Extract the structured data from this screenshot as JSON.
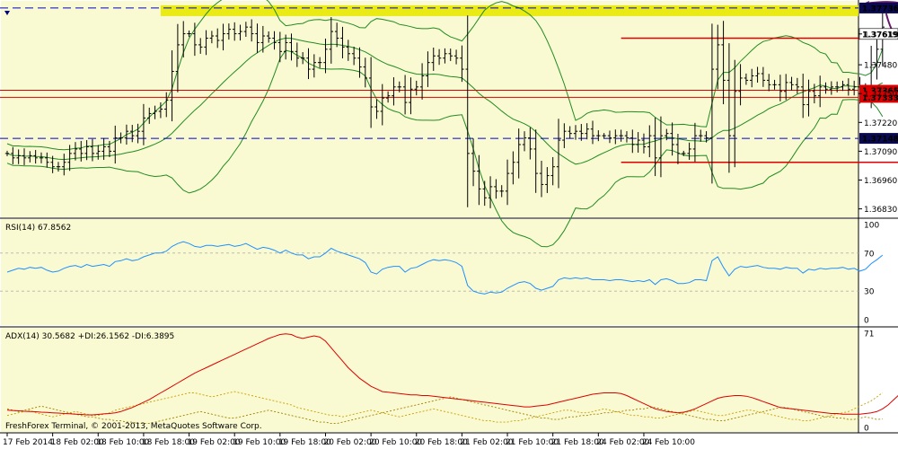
{
  "terminal": {
    "copyright": "FreshForex Terminal, © 2001-2013, MetaQuotes Software Corp."
  },
  "colors": {
    "background": "#fafad2",
    "price_bars": "#000000",
    "bands": "#228b22",
    "horizontal_lines": "#dd0000",
    "dashed_lines": "#0000cc",
    "highlight": "#e8e800",
    "rsi_line": "#1e90ff",
    "adx_line": "#dd0000",
    "di_plus": "#c8a000",
    "di_minus": "#a08000",
    "arrow": "#6a1a6a",
    "label_dark": "#0a0a50",
    "label_red": "#dd0000"
  },
  "chart_data": [
    {
      "type": "line",
      "panel": "price",
      "y_ticks": [
        "1.37619",
        "1.37480",
        "1.37350",
        "1.37220",
        "1.37090",
        "1.36960",
        "1.36830"
      ],
      "ylim": [
        1.368,
        1.3776
      ],
      "levels": [
        {
          "price": 1.37736,
          "label": "1.37736",
          "style": "dashed"
        },
        {
          "price": 1.37619,
          "label": "1.37619",
          "style": "price"
        },
        {
          "price": 1.37365,
          "label": "1.37365",
          "style": "solid"
        },
        {
          "price": 1.37333,
          "label": "1.37333",
          "style": "solid"
        },
        {
          "price": 1.37148,
          "label": "1.37148",
          "style": "dashed"
        }
      ],
      "segments": [
        {
          "price": 1.376,
          "from_index": 108,
          "to_index": 158
        },
        {
          "price": 1.3704,
          "from_index": 108,
          "to_index": 158
        }
      ],
      "x_labels": [
        "17 Feb 2014",
        "18 Feb 02:00",
        "18 Feb 10:00",
        "18 Feb 18:00",
        "19 Feb 02:00",
        "19 Feb 10:00",
        "19 Feb 18:00",
        "20 Feb 02:00",
        "20 Feb 10:00",
        "20 Feb 18:00",
        "21 Feb 02:00",
        "21 Feb 10:00",
        "21 Feb 18:00",
        "24 Feb 02:00",
        "24 Feb 10:00"
      ],
      "closes": [
        1.3708,
        1.3706,
        1.3707,
        1.3706,
        1.3707,
        1.3706,
        1.3706,
        1.3704,
        1.3702,
        1.3702,
        1.3704,
        1.3708,
        1.371,
        1.3708,
        1.3711,
        1.3708,
        1.3709,
        1.3711,
        1.3709,
        1.3715,
        1.3715,
        1.3718,
        1.3716,
        1.3718,
        1.3724,
        1.3726,
        1.3727,
        1.3728,
        1.3732,
        1.3745,
        1.3757,
        1.3762,
        1.3762,
        1.3757,
        1.3756,
        1.376,
        1.3761,
        1.3759,
        1.3762,
        1.3764,
        1.3762,
        1.3763,
        1.3765,
        1.3762,
        1.3758,
        1.3761,
        1.376,
        1.3758,
        1.3754,
        1.3758,
        1.3754,
        1.3751,
        1.3751,
        1.3746,
        1.3749,
        1.3749,
        1.3755,
        1.3763,
        1.376,
        1.3756,
        1.3753,
        1.3751,
        1.3747,
        1.3742,
        1.3729,
        1.3727,
        1.3733,
        1.3734,
        1.3738,
        1.3738,
        1.3731,
        1.3737,
        1.3738,
        1.3743,
        1.3749,
        1.3752,
        1.3751,
        1.3753,
        1.3752,
        1.3751,
        1.3746,
        1.3708,
        1.37,
        1.3692,
        1.3688,
        1.3693,
        1.3691,
        1.3691,
        1.3699,
        1.3704,
        1.3712,
        1.3715,
        1.371,
        1.3699,
        1.3694,
        1.3698,
        1.3702,
        1.3714,
        1.3718,
        1.3717,
        1.3718,
        1.3717,
        1.3719,
        1.3716,
        1.3716,
        1.3716,
        1.3715,
        1.3716,
        1.3716,
        1.3715,
        1.3712,
        1.3714,
        1.3711,
        1.3716,
        1.3706,
        1.3716,
        1.3717,
        1.3712,
        1.3708,
        1.3708,
        1.371,
        1.3716,
        1.3716,
        1.3715,
        1.3746,
        1.3757,
        1.3741,
        1.3716,
        1.3736,
        1.3742,
        1.3741,
        1.3743,
        1.3744,
        1.3741,
        1.3739,
        1.3739,
        1.3736,
        1.374,
        1.3739,
        1.3738,
        1.373,
        1.3736,
        1.3734,
        1.3738,
        1.3737,
        1.3738,
        1.3738,
        1.3739,
        1.3737,
        1.3738,
        1.3735,
        1.3737,
        1.3748,
        1.3755,
        1.3765
      ],
      "rsi_values": [
        50,
        52,
        54,
        53,
        55,
        54,
        55,
        52,
        50,
        51,
        54,
        56,
        57,
        55,
        58,
        56,
        57,
        58,
        56,
        61,
        62,
        64,
        62,
        63,
        66,
        68,
        70,
        70,
        72,
        77,
        80,
        82,
        80,
        77,
        76,
        78,
        78,
        77,
        78,
        79,
        77,
        78,
        80,
        77,
        74,
        76,
        75,
        73,
        70,
        73,
        70,
        68,
        68,
        64,
        66,
        66,
        70,
        75,
        72,
        70,
        68,
        66,
        64,
        60,
        50,
        48,
        53,
        55,
        56,
        56,
        50,
        54,
        55,
        58,
        61,
        63,
        62,
        63,
        62,
        60,
        56,
        36,
        30,
        28,
        27,
        29,
        28,
        29,
        33,
        36,
        39,
        40,
        38,
        33,
        31,
        33,
        35,
        42,
        44,
        43,
        44,
        43,
        44,
        42,
        42,
        42,
        41,
        42,
        42,
        41,
        40,
        41,
        40,
        42,
        37,
        42,
        43,
        41,
        38,
        38,
        39,
        42,
        42,
        41,
        62,
        66,
        55,
        46,
        53,
        56,
        55,
        56,
        57,
        55,
        54,
        54,
        53,
        55,
        54,
        54,
        49,
        53,
        52,
        54,
        53,
        54,
        54,
        55,
        53,
        54,
        51,
        53,
        59,
        63,
        67.8562
      ],
      "adx_values": [
        13.0,
        12.8,
        12.5,
        12.2,
        12.0,
        11.8,
        11.5,
        11.3,
        11.0,
        10.8,
        10.5,
        10.3,
        10.0,
        9.8,
        9.5,
        9.5,
        9.8,
        10.2,
        10.5,
        11.0,
        12.0,
        13.5,
        15.0,
        17.0,
        19.0,
        21.0,
        23.5,
        26.0,
        28.5,
        31.0,
        33.5,
        36.0,
        38.5,
        41.0,
        43.0,
        45.0,
        47.0,
        49.0,
        51.0,
        53.0,
        55.0,
        57.0,
        59.0,
        61.0,
        63.0,
        65.0,
        67.0,
        68.5,
        70.0,
        70.5,
        70.0,
        68.0,
        67.0,
        68.0,
        69.0,
        68.0,
        65.0,
        60.0,
        55.0,
        50.0,
        45.0,
        41.0,
        37.0,
        34.0,
        31.0,
        29.0,
        27.0,
        26.5,
        26.0,
        25.5,
        25.0,
        24.5,
        24.5,
        24.0,
        24.0,
        23.5,
        23.0,
        22.5,
        22.0,
        21.5,
        21.0,
        20.5,
        20.0,
        19.5,
        19.0,
        18.5,
        18.0,
        17.5,
        17.0,
        16.5,
        16.0,
        15.5,
        15.5,
        16.0,
        16.5,
        17.0,
        18.0,
        19.0,
        20.0,
        21.0,
        22.0,
        23.0,
        24.0,
        25.0,
        25.5,
        26.0,
        26.0,
        26.0,
        25.5,
        24.0,
        22.0,
        20.0,
        18.0,
        16.0,
        14.0,
        13.0,
        12.0,
        11.5,
        11.0,
        11.5,
        12.5,
        14.0,
        16.0,
        18.0,
        20.0,
        22.0,
        23.0,
        23.5,
        24.0,
        24.0,
        23.5,
        22.5,
        21.0,
        19.5,
        18.0,
        16.5,
        15.0,
        14.5,
        14.0,
        13.5,
        13.0,
        12.5,
        12.0,
        11.5,
        11.0,
        10.5,
        10.5,
        10.0,
        10.0,
        10.0,
        10.0,
        10.5,
        11.0,
        12.0,
        14.0,
        17.0,
        21.0,
        25.0,
        30.5682
      ],
      "di_plus_values": [
        9,
        10,
        11,
        12,
        13,
        11,
        10,
        9,
        8,
        9,
        10,
        11,
        12,
        11,
        10,
        9,
        9,
        10,
        11,
        13,
        14,
        15,
        16,
        17,
        18,
        19,
        20,
        21,
        22,
        23,
        24,
        25,
        26,
        26,
        25,
        24,
        23,
        24,
        25,
        26,
        27,
        26,
        25,
        24,
        23,
        22,
        21,
        20,
        19,
        18,
        17,
        15,
        14,
        13,
        12,
        11,
        10,
        9,
        9,
        8,
        9,
        10,
        11,
        12,
        13,
        12,
        11,
        10,
        9,
        8,
        9,
        10,
        11,
        12,
        13,
        14,
        13,
        12,
        11,
        10,
        9,
        8,
        7,
        6,
        5,
        5,
        4,
        4,
        4,
        5,
        5,
        6,
        7,
        8,
        9,
        10,
        11,
        12,
        13,
        13,
        12,
        11,
        11,
        12,
        13,
        14,
        13,
        12,
        11,
        10,
        9,
        9,
        8,
        8,
        7,
        7,
        8,
        9,
        10,
        11,
        12,
        13,
        12,
        11,
        10,
        9,
        9,
        10,
        11,
        12,
        13,
        13,
        12,
        11,
        10,
        9,
        8,
        7,
        6,
        6,
        5,
        5,
        6,
        7,
        8,
        9,
        10,
        11,
        12,
        14,
        16,
        18,
        20,
        23,
        26.1562
      ],
      "di_minus_values": [
        14,
        13,
        12,
        13,
        14,
        15,
        16,
        15,
        14,
        13,
        12,
        11,
        10,
        9,
        8,
        8,
        7,
        6,
        6,
        5,
        5,
        4,
        4,
        3,
        3,
        3,
        4,
        5,
        6,
        7,
        8,
        9,
        10,
        11,
        12,
        11,
        10,
        9,
        8,
        7,
        7,
        8,
        9,
        10,
        11,
        12,
        13,
        12,
        11,
        10,
        9,
        8,
        7,
        6,
        5,
        4,
        4,
        3,
        3,
        4,
        5,
        6,
        7,
        8,
        9,
        10,
        11,
        12,
        13,
        14,
        15,
        16,
        17,
        18,
        19,
        20,
        21,
        22,
        23,
        22,
        21,
        20,
        19,
        18,
        17,
        16,
        15,
        14,
        13,
        12,
        11,
        10,
        9,
        8,
        7,
        7,
        6,
        6,
        7,
        8,
        8,
        9,
        9,
        10,
        10,
        11,
        11,
        12,
        12,
        13,
        13,
        14,
        14,
        15,
        15,
        14,
        13,
        12,
        11,
        10,
        9,
        8,
        7,
        6,
        6,
        5,
        5,
        6,
        7,
        8,
        9,
        10,
        11,
        12,
        13,
        14,
        15,
        15,
        14,
        13,
        12,
        11,
        10,
        9,
        8,
        8,
        7,
        7,
        6,
        6,
        7,
        8,
        7,
        6,
        6.3895
      ]
    },
    {
      "type": "line",
      "panel": "rsi",
      "label": "RSI(14) 67.8562",
      "levels_labels": [
        "100",
        "70",
        "30",
        "0"
      ],
      "ylim": [
        0,
        100
      ]
    },
    {
      "type": "line",
      "panel": "adx",
      "label": "ADX(14) 30.5682 +DI:26.1562 -DI:6.3895",
      "levels_labels": [
        "71",
        "0"
      ],
      "ylim": [
        0,
        71
      ]
    }
  ]
}
